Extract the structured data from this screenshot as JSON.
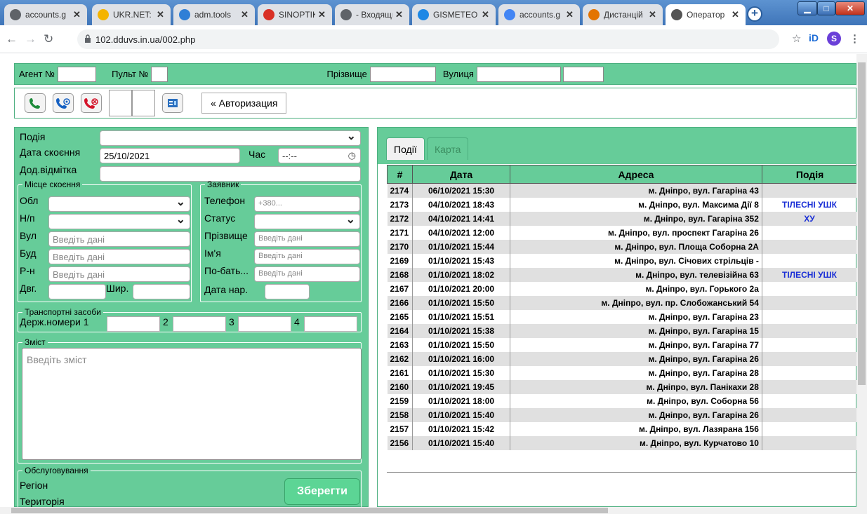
{
  "browser": {
    "tabs": [
      {
        "title": "accounts.g",
        "icon": "globe-icon",
        "color": "#5f6368"
      },
      {
        "title": "UKR.NET: I",
        "icon": "ukrnet-icon",
        "color": "#f4b400"
      },
      {
        "title": "adm.tools",
        "icon": "cloud-icon",
        "color": "#2f7fd6"
      },
      {
        "title": "SINOPTIK:",
        "icon": "thermometer-icon",
        "color": "#d93025"
      },
      {
        "title": "- Входящи",
        "icon": "globe-icon",
        "color": "#5f6368"
      },
      {
        "title": "GISMETEO",
        "icon": "drop-icon",
        "color": "#1e88e5"
      },
      {
        "title": "accounts.g",
        "icon": "google-icon",
        "color": "#4285f4"
      },
      {
        "title": "Дистанцій",
        "icon": "course-icon",
        "color": "#e37400"
      },
      {
        "title": "Оператор",
        "icon": "operator-icon",
        "color": "#555555"
      }
    ],
    "url": "102.dduvs.in.ua/002.php"
  },
  "topbar": {
    "agent_label": "Агент №",
    "agent_value": "",
    "console_label": "Пульт №",
    "console_value": "",
    "surname_label": "Прізвище",
    "surname_value": "",
    "street_label": "Вулиця",
    "street_value": "",
    "extra_value": ""
  },
  "toolbar": {
    "auth_label": "« Авторизация"
  },
  "form": {
    "event_label": "Подія",
    "event_value": "",
    "date_label": "Дата скоєння",
    "date_value": "25/10/2021",
    "time_label": "Час",
    "time_value": "--:--",
    "mark_label": "Дод.відмітка",
    "place_legend": "Місце скоєння",
    "region_label": "Обл",
    "city_label": "Н/п",
    "street_label": "Вул",
    "street_ph": "Введіть дані",
    "building_label": "Буд",
    "building_ph": "Введіть дані",
    "district_label": "Р-н",
    "district_ph": "Введіть дані",
    "lon_label": "Двг.",
    "lat_label": "Шир.",
    "applicant_legend": "Заявник",
    "phone_label": "Телефон",
    "phone_ph": "+380...",
    "status_label": "Статус",
    "app_surname_label": "Прізвище",
    "app_surname_ph": "Введіть дані",
    "name_label": "Ім'я",
    "name_ph": "Введіть дані",
    "patronymic_label": "По-бать...",
    "patronymic_ph": "Введіть дані",
    "birth_label": "Дата нар.",
    "vehicles_legend": "Транспортні засоби",
    "plates_label": "Держ.номери 1",
    "plate2_label": "2",
    "plate3_label": "3",
    "plate4_label": "4",
    "content_legend": "Зміст",
    "content_ph": "Введіть зміст",
    "service_legend": "Обслуговування",
    "service_region_label": "Регіон",
    "service_territory_label": "Територія",
    "save_label": "Зберегти"
  },
  "events": {
    "tab_events": "Події",
    "tab_map": "Карта",
    "columns": [
      "#",
      "Дата",
      "Адреса",
      "Подія"
    ],
    "rows": [
      {
        "id": "2174",
        "date": "06/10/2021 15:30",
        "address": "м. Дніпро, вул. Гагаріна 43",
        "event": ""
      },
      {
        "id": "2173",
        "date": "04/10/2021 18:43",
        "address": "м. Дніпро, вул. Максима Дії 8",
        "event": "ТІЛЕСНІ УШК"
      },
      {
        "id": "2172",
        "date": "04/10/2021 14:41",
        "address": "м. Дніпро, вул. Гагаріна 352",
        "event": "ХУ"
      },
      {
        "id": "2171",
        "date": "04/10/2021 12:00",
        "address": "м. Дніпро, вул. проспект Гагаріна 26",
        "event": ""
      },
      {
        "id": "2170",
        "date": "01/10/2021 15:44",
        "address": "м. Дніпро, вул. Площа Соборна 2А",
        "event": ""
      },
      {
        "id": "2169",
        "date": "01/10/2021 15:43",
        "address": "м. Дніпро, вул. Січових стрільців -",
        "event": ""
      },
      {
        "id": "2168",
        "date": "01/10/2021 18:02",
        "address": "м. Дніпро, вул. телевізійна 63",
        "event": "ТІЛЕСНІ УШК"
      },
      {
        "id": "2167",
        "date": "01/10/2021 20:00",
        "address": "м. Дніпро, вул. Горького 2а",
        "event": ""
      },
      {
        "id": "2166",
        "date": "01/10/2021 15:50",
        "address": "м. Дніпро, вул. пр. Слобожанський 54",
        "event": ""
      },
      {
        "id": "2165",
        "date": "01/10/2021 15:51",
        "address": "м. Дніпро, вул. Гагаріна 23",
        "event": ""
      },
      {
        "id": "2164",
        "date": "01/10/2021 15:38",
        "address": "м. Дніпро, вул. Гагаріна 15",
        "event": ""
      },
      {
        "id": "2163",
        "date": "01/10/2021 15:50",
        "address": "м. Дніпро, вул. Гагаріна 77",
        "event": ""
      },
      {
        "id": "2162",
        "date": "01/10/2021 16:00",
        "address": "м. Дніпро, вул. Гагаріна 26",
        "event": ""
      },
      {
        "id": "2161",
        "date": "01/10/2021 15:30",
        "address": "м. Дніпро, вул. Гагаріна 28",
        "event": ""
      },
      {
        "id": "2160",
        "date": "01/10/2021 19:45",
        "address": "м. Дніпро, вул. Панікахи 28",
        "event": ""
      },
      {
        "id": "2159",
        "date": "01/10/2021 18:00",
        "address": "м. Дніпро, вул. Соборна 56",
        "event": ""
      },
      {
        "id": "2158",
        "date": "01/10/2021 15:40",
        "address": "м. Дніпро, вул. Гагаріна 26",
        "event": ""
      },
      {
        "id": "2157",
        "date": "01/10/2021 15:42",
        "address": "м. Дніпро, вул. Лазярана 156",
        "event": ""
      },
      {
        "id": "2156",
        "date": "01/10/2021 15:40",
        "address": "м. Дніпро, вул. Курчатово 10",
        "event": ""
      }
    ]
  }
}
